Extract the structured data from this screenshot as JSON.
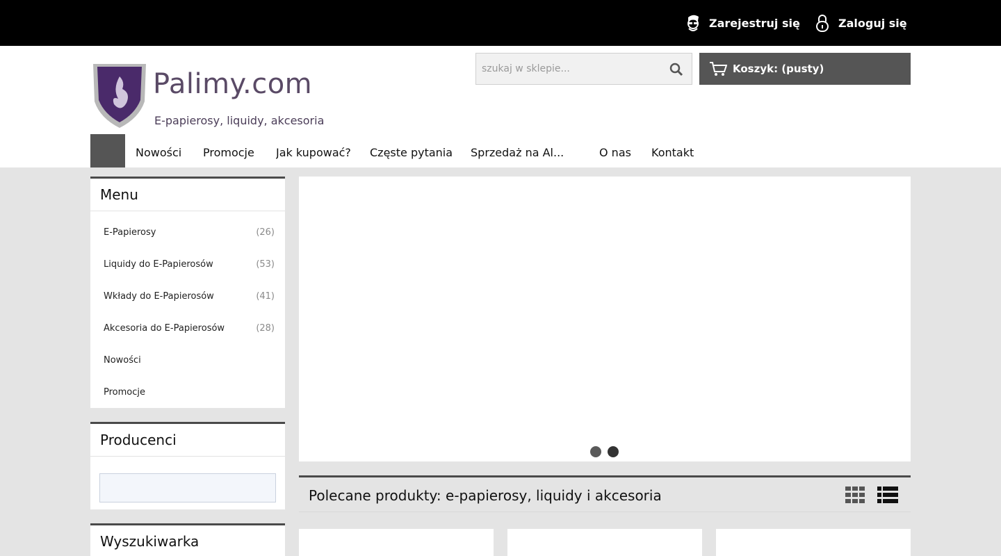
{
  "topbar": {
    "register_label": "Zarejestruj się",
    "login_label": "Zaloguj się"
  },
  "header": {
    "logo_brand": "Palimy.com",
    "logo_tagline": "E-papierosy, liquidy, akcesoria",
    "search_placeholder": "szukaj w sklepie...",
    "cart_label": "Koszyk: (pusty)"
  },
  "nav": {
    "items": [
      "Nowości",
      "Promocje",
      "Jak kupować?",
      "Częste pytania",
      "Sprzedaż na Al...",
      "O nas",
      "Kontakt"
    ]
  },
  "sidebar": {
    "menu_title": "Menu",
    "menu": [
      {
        "label": "E-Papierosy",
        "count": "(26)"
      },
      {
        "label": "Liquidy do E-Papierosów",
        "count": "(53)"
      },
      {
        "label": "Wkłady do E-Papierosów",
        "count": "(41)"
      },
      {
        "label": "Akcesoria do E-Papierosów",
        "count": "(28)"
      },
      {
        "label": "Nowości",
        "count": ""
      },
      {
        "label": "Promocje",
        "count": ""
      }
    ],
    "producers_title": "Producenci",
    "search_title": "Wyszukiwarka"
  },
  "featured": {
    "title": "Polecane produkty: e-papierosy, liquidy i akcesoria"
  },
  "colors": {
    "topbar": "#000000",
    "accent_dark": "#555555",
    "page_bg": "#e4e4e4"
  }
}
